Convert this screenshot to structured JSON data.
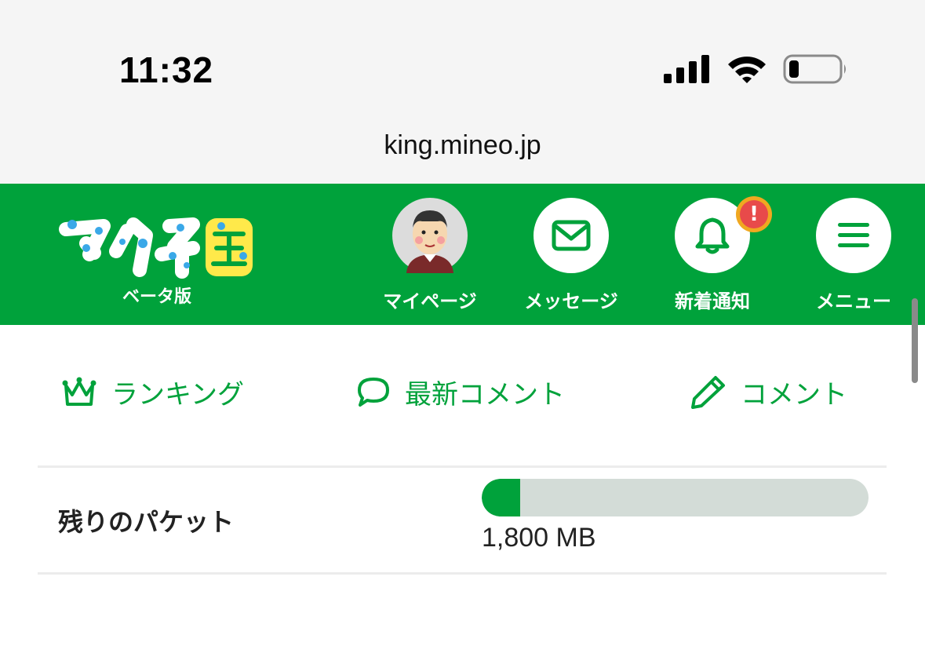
{
  "status_bar": {
    "time": "11:32"
  },
  "browser": {
    "url": "king.mineo.jp"
  },
  "header": {
    "logo_text": "マイネ王",
    "beta_label": "ベータ版",
    "nav": [
      {
        "label": "マイページ",
        "icon": "avatar-icon"
      },
      {
        "label": "メッセージ",
        "icon": "envelope-icon"
      },
      {
        "label": "新着通知",
        "icon": "bell-icon",
        "badge": "!"
      },
      {
        "label": "メニュー",
        "icon": "hamburger-icon"
      }
    ],
    "accent_color": "#00a23b",
    "badge_color": "#e84a4a"
  },
  "subnav": [
    {
      "label": "ランキング",
      "icon": "crown-icon"
    },
    {
      "label": "最新コメント",
      "icon": "speech-bubble-icon"
    },
    {
      "label": "コメント",
      "icon": "pencil-icon"
    }
  ],
  "packet": {
    "label": "残りのパケット",
    "value": "1,800 MB",
    "remaining_fraction": 0.1
  }
}
